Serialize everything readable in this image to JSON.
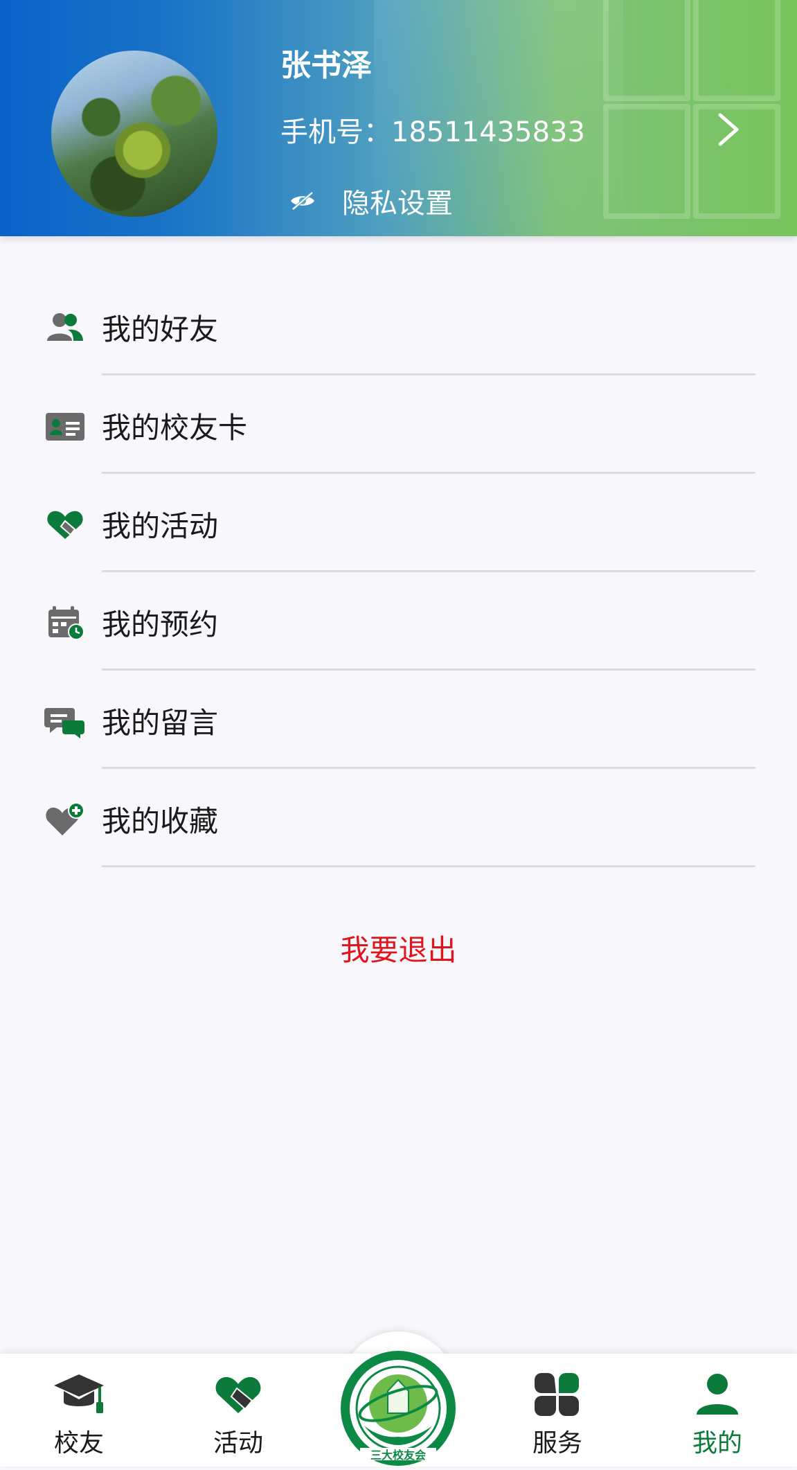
{
  "profile": {
    "name": "张书泽",
    "phone_label": "手机号：",
    "phone": "18511435833",
    "privacy_label": "隐私设置"
  },
  "menu": {
    "items": [
      {
        "label": "我的好友",
        "icon": "friends-icon"
      },
      {
        "label": "我的校友卡",
        "icon": "id-card-icon"
      },
      {
        "label": "我的活动",
        "icon": "handshake-heart-icon"
      },
      {
        "label": "我的预约",
        "icon": "calendar-clock-icon"
      },
      {
        "label": "我的留言",
        "icon": "chat-bubbles-icon"
      },
      {
        "label": "我的收藏",
        "icon": "heart-plus-icon"
      }
    ],
    "logout_label": "我要退出"
  },
  "tabbar": {
    "tabs": [
      {
        "label": "校友",
        "icon": "graduation-cap-icon"
      },
      {
        "label": "活动",
        "icon": "handshake-heart-icon"
      },
      {
        "label": "服务",
        "icon": "clover-icon"
      },
      {
        "label": "我的",
        "icon": "user-icon"
      }
    ],
    "active": "我的",
    "center_logo_text": "三大校友会"
  },
  "colors": {
    "accent_green": "#0c7a3a",
    "icon_gray": "#6b6b6b",
    "logout_red": "#e0141b",
    "header_blue": "#0a62c9",
    "header_green": "#78c45c"
  }
}
